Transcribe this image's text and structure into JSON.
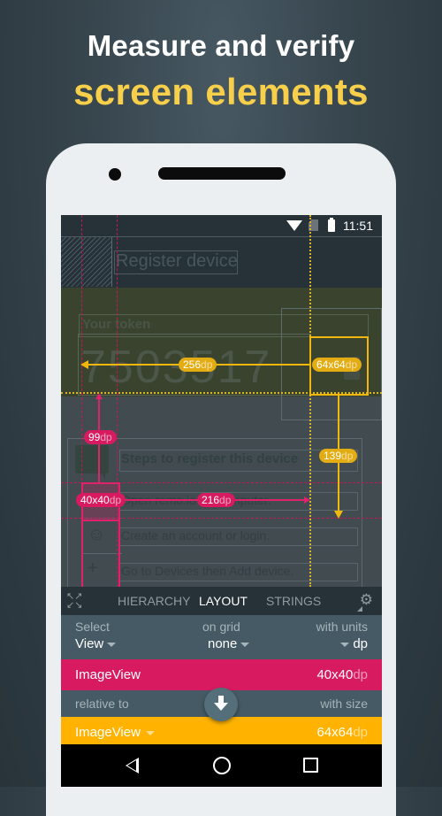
{
  "headline": {
    "line1": "Measure and verify",
    "line2": "screen elements",
    "line2_color": "#f7cf4a"
  },
  "status_bar": {
    "time": "11:51",
    "icons": [
      "wifi-icon",
      "no-sim-icon",
      "battery-icon"
    ]
  },
  "app_under_inspection": {
    "title": "Register device",
    "token_label": "Your token",
    "token_value": "7503517",
    "steps_title": "Steps to register this device",
    "steps": [
      {
        "icon": "computer-icon",
        "text": "Open remo.io on computer."
      },
      {
        "icon": "person-icon",
        "text": "Create an account or login."
      },
      {
        "icon": "plus-icon",
        "text": "Go to Devices then Add device."
      }
    ]
  },
  "measurements": {
    "yellow_size": {
      "value": "64x64",
      "unit": "dp"
    },
    "horizontal_distance": {
      "value": "256",
      "unit": "dp"
    },
    "vertical_distance_yellow": {
      "value": "139",
      "unit": "dp"
    },
    "vertical_distance_pink": {
      "value": "99",
      "unit": "dp"
    },
    "pink_size": {
      "value": "40x40",
      "unit": "dp"
    },
    "pink_horizontal_distance": {
      "value": "216",
      "unit": "dp"
    },
    "colors": {
      "primary": "#d81b60",
      "secondary": "#ffb300"
    }
  },
  "panel": {
    "tabs": [
      {
        "label": "HIERARCHY",
        "active": false
      },
      {
        "label": "LAYOUT",
        "active": true
      },
      {
        "label": "STRINGS",
        "active": false
      }
    ],
    "select": {
      "label": "Select",
      "value": "View"
    },
    "grid": {
      "label": "on grid",
      "value": "none"
    },
    "units": {
      "label": "with units",
      "value": "dp"
    },
    "primary_row": {
      "label": "ImageView",
      "size": "40x40",
      "unit": "dp"
    },
    "relative_label": "relative to",
    "size_label": "with size",
    "secondary_row": {
      "label": "ImageView",
      "size": "64x64",
      "unit": "dp"
    }
  },
  "navbar": {
    "buttons": [
      "back",
      "home",
      "recents"
    ]
  }
}
